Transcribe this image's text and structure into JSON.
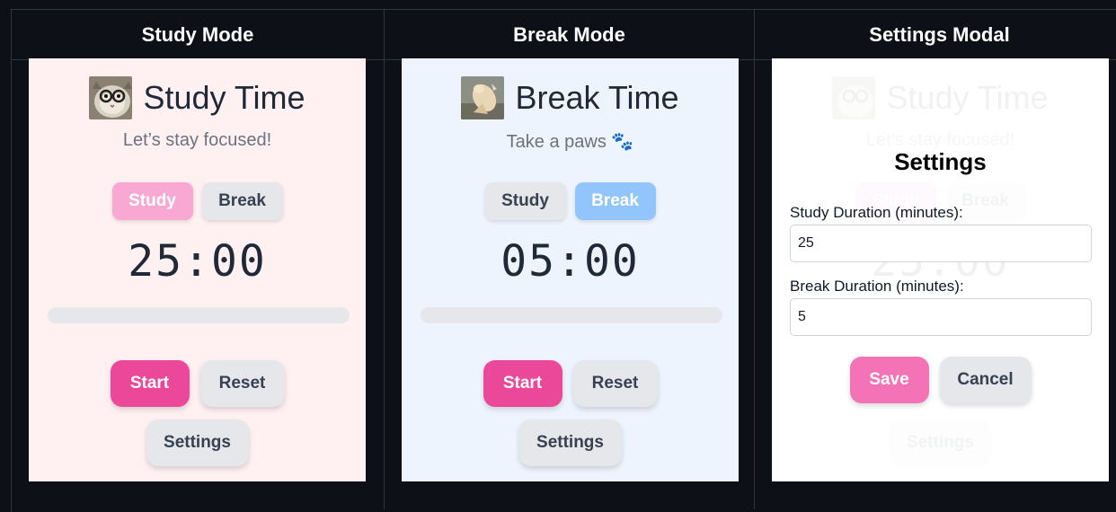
{
  "headers": {
    "study": "Study Mode",
    "break": "Break Mode",
    "settings": "Settings Modal"
  },
  "study_panel": {
    "title": "Study Time",
    "subtitle": "Let’s stay focused!",
    "tab_study": "Study",
    "tab_break": "Break",
    "timer": "25:00",
    "progress": 0,
    "start": "Start",
    "reset": "Reset",
    "settings": "Settings",
    "bg": "#fff0f1"
  },
  "break_panel": {
    "title": "Break Time",
    "subtitle": "Take a paws 🐾",
    "tab_study": "Study",
    "tab_break": "Break",
    "timer": "05:00",
    "progress": 0,
    "start": "Start",
    "reset": "Reset",
    "settings": "Settings",
    "bg": "#eef4fd"
  },
  "settings_modal": {
    "title": "Settings",
    "study_label": "Study Duration (minutes):",
    "study_value": "25",
    "break_label": "Break Duration (minutes):",
    "break_value": "5",
    "save": "Save",
    "cancel": "Cancel",
    "bg_title": "Study Time",
    "bg_subtitle": "Let’s stay focused!",
    "bg_timer": "25:00",
    "bg_tab_study": "Study",
    "bg_tab_break": "Break",
    "bg_settings": "Settings"
  },
  "colors": {
    "accent_pink": "#ec4899",
    "study_tab_active": "#f9a8d4",
    "break_tab_active": "#93c5fd",
    "page_bg": "#0d1117"
  },
  "icons": {
    "study_avatar": "cat-with-glasses-photo",
    "break_avatar": "cat-stretching-photo"
  }
}
